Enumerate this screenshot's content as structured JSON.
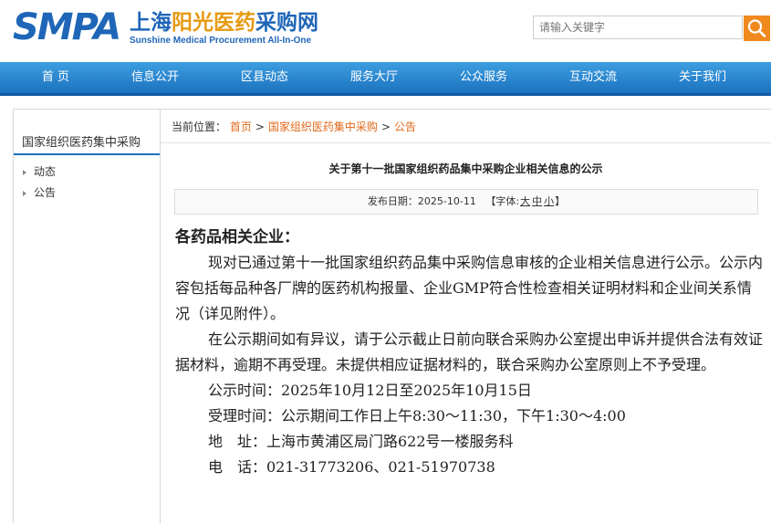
{
  "header": {
    "logo_text": "SMPA",
    "logo_cn_a": "上海",
    "logo_cn_b": "阳光医药",
    "logo_cn_c": "采购网",
    "logo_en": "Sunshine Medical Procurement All-In-One",
    "search_placeholder": "请输入关键字",
    "search_icon": "search-icon"
  },
  "nav": {
    "items": [
      "首 页",
      "信息公开",
      "区县动态",
      "服务大厅",
      "公众服务",
      "互动交流",
      "关于我们"
    ]
  },
  "sidebar": {
    "title": "国家组织医药集中采购",
    "items": [
      "动态",
      "公告"
    ]
  },
  "breadcrumb": {
    "label": "当前位置：",
    "items": [
      "首页",
      "国家组织医药集中采购",
      "公告"
    ]
  },
  "article": {
    "title": "关于第十一批国家组织药品集中采购企业相关信息的公示",
    "date_label": "发布日期：",
    "date": "2025-10-11",
    "font_label": "【字体:",
    "font_large": "大",
    "font_medium": "中",
    "font_small": "小",
    "font_end": "】",
    "greeting": "各药品相关企业：",
    "para1": "现对已通过第十一批国家组织药品集中采购信息审核的企业相关信息进行公示。公示内容包括每品种各厂牌的医药机构报量、企业GMP符合性检查相关证明材料和企业间关系情况（详见附件）。",
    "para2": "在公示期间如有异议，请于公示截止日前向联合采购办公室提出申诉并提供合法有效证据材料，逾期不再受理。未提供相应证据材料的，联合采购办公室原则上不予受理。",
    "notice_time": "公示时间：2025年10月12日至2025年10月15日",
    "accept_time": "受理时间：公示期间工作日上午8:30～11:30，下午1:30～4:00",
    "address": "地　址：上海市黄浦区局门路622号一楼服务科",
    "phone": "电　话：021-31773206、021-51970738"
  },
  "colors": {
    "brand_blue": "#1f66b8",
    "accent_orange": "#e69a12",
    "link_orange": "#e06a1b",
    "nav_blue": "#1c72bf"
  }
}
